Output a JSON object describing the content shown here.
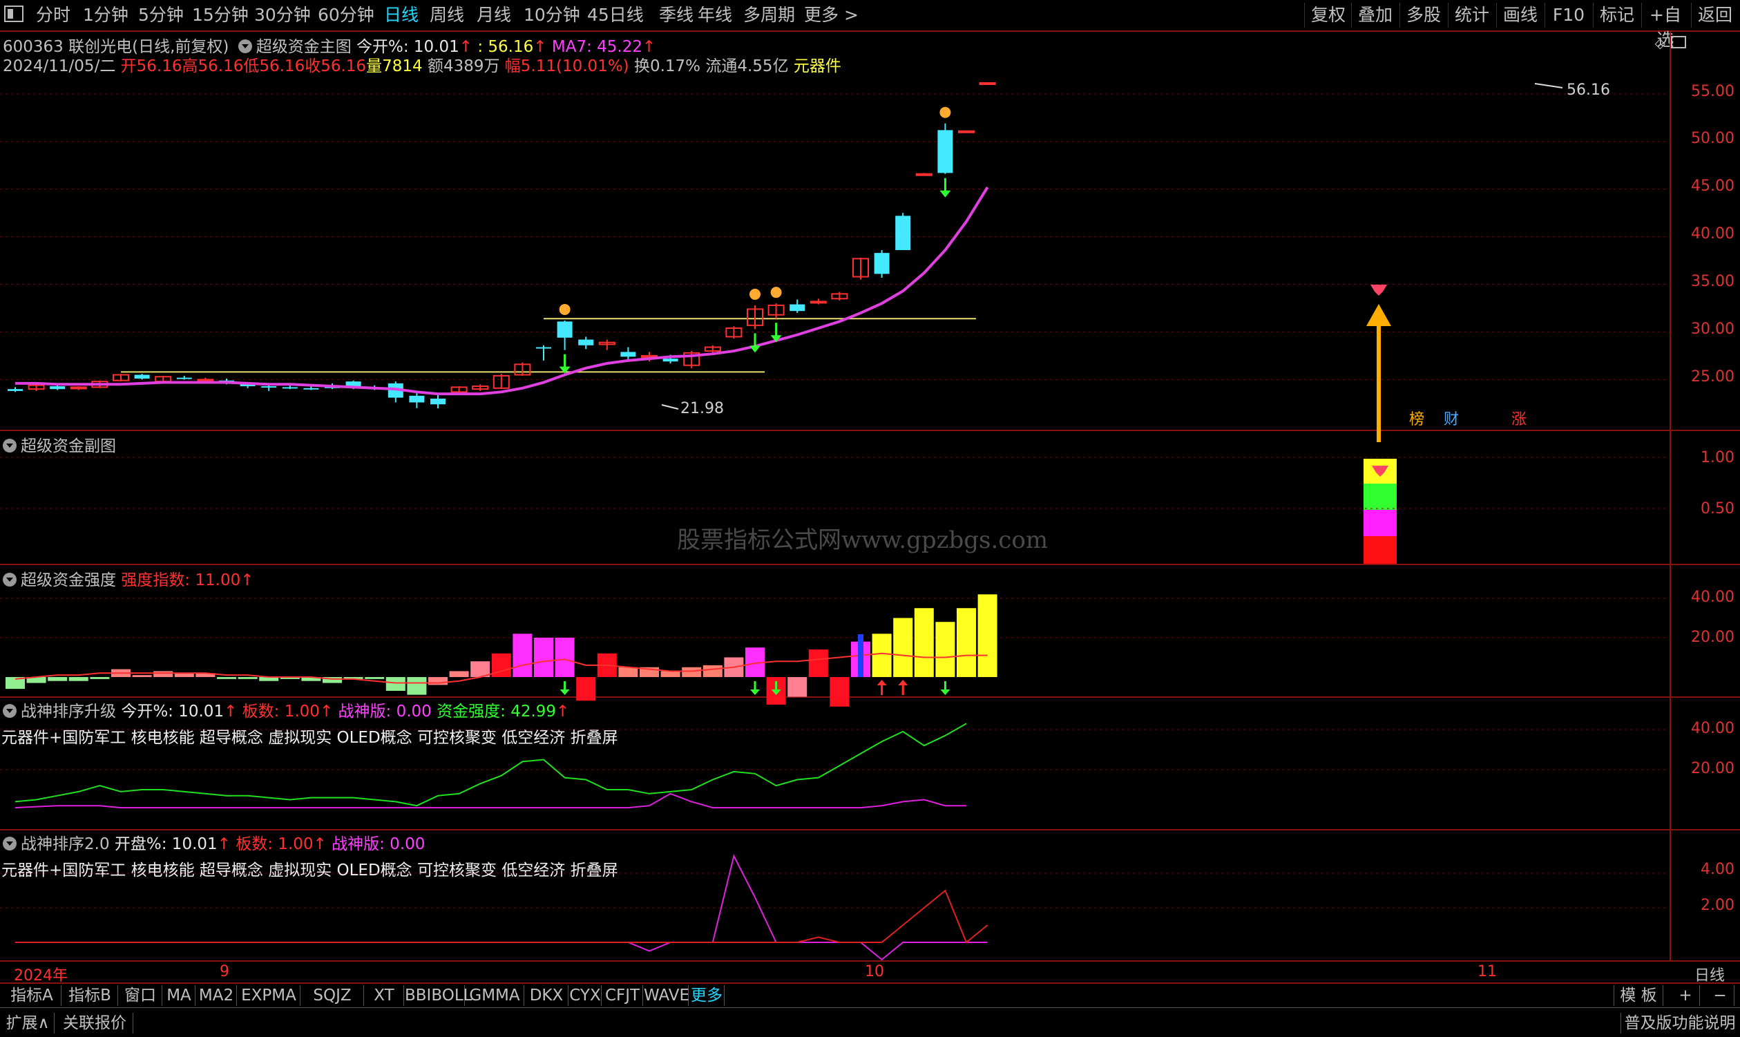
{
  "toolbar": {
    "periods": [
      {
        "label": "分时",
        "active": false
      },
      {
        "label": "1分钟",
        "active": false
      },
      {
        "label": "5分钟",
        "active": false
      },
      {
        "label": "15分钟",
        "active": false
      },
      {
        "label": "30分钟",
        "active": false
      },
      {
        "label": "60分钟",
        "active": false
      },
      {
        "label": "日线",
        "active": true
      },
      {
        "label": "周线",
        "active": false
      },
      {
        "label": "月线",
        "active": false
      },
      {
        "label": "10分钟",
        "active": false
      },
      {
        "label": "45日线",
        "active": false
      },
      {
        "label": "季线",
        "active": false
      },
      {
        "label": "年线",
        "active": false
      },
      {
        "label": "多周期",
        "active": false
      },
      {
        "label": "更多 >",
        "active": false
      }
    ],
    "right_buttons": [
      "复权",
      "叠加",
      "多股",
      "统计",
      "画线",
      "F10",
      "标记",
      "+自选",
      "返回"
    ]
  },
  "main_panel": {
    "stock_title": "600363 联创光电(日线,前复权)",
    "indicator_name": "超级资金主图",
    "today_open_label": "今开%: 10.01",
    "price_label": ": 56.16",
    "ma7_label": "MA7: 45.22",
    "date": "2024/11/05/二",
    "open": "开56.16",
    "high": "高56.16",
    "low": "低56.16",
    "close": "收56.16",
    "volume": "量7814",
    "amount": "额4389万",
    "change": "幅5.11(10.01%)",
    "turnover": "换0.17%",
    "float_cap": "流通4.55亿",
    "sector": "元器件",
    "high_mark": "56.16",
    "low_mark": "21.98",
    "tags": [
      "榜",
      "财",
      "涨"
    ],
    "y_ticks": [
      "55.00",
      "50.00",
      "45.00",
      "40.00",
      "35.00",
      "30.00",
      "25.00"
    ]
  },
  "sub_panel": {
    "title": "超级资金副图",
    "y_ticks": [
      "1.00",
      "0.50"
    ],
    "watermark": "股票指标公式网www.gpzbgs.com"
  },
  "strength_panel": {
    "title": "超级资金强度",
    "index_label": "强度指数: 11.00",
    "y_ticks": [
      "40.00",
      "20.00"
    ]
  },
  "zs_upgrade_panel": {
    "title": "战神排序升级",
    "open_label": "今开%: 10.01",
    "board_label": "板数: 1.00",
    "zsb_label": "战神版: 0.00",
    "fund_label": "资金强度: 42.99",
    "concepts": "元器件+国防军工 核电核能 超导概念 虚拟现实 OLED概念 可控核聚变 低空经济 折叠屏",
    "y_ticks": [
      "40.00",
      "20.00"
    ]
  },
  "zs2_panel": {
    "title": "战神排序2.0",
    "open_label": "开盘%: 10.01",
    "board_label": "板数: 1.00",
    "zsb_label": "战神版: 0.00",
    "concepts": "元器件+国防军工 核电核能 超导概念 虚拟现实 OLED概念 可控核聚变 低空经济 折叠屏",
    "y_ticks": [
      "4.00",
      "2.00"
    ]
  },
  "date_axis": {
    "labels": [
      "2024年",
      "9",
      "10",
      "11"
    ],
    "period_label": "日线"
  },
  "indicator_tabs": [
    "指标A",
    "指标B",
    "窗口",
    "MA",
    "MA2",
    "EXPMA",
    "SQJZ",
    "XT",
    "BBIBOLL",
    "GMMA",
    "DKX",
    "CYX",
    "CFJT",
    "WAVE",
    "更多"
  ],
  "indicator_right": [
    "模 板",
    "+",
    "−"
  ],
  "bottom_bar": {
    "left": [
      "扩展∧",
      "关联报价"
    ],
    "right": "普及版功能说明"
  },
  "colors": {
    "up": "#ff3030",
    "down": "#44e8ff",
    "ma": "#e040e0",
    "grid": "#8b1010"
  },
  "chart_data": {
    "type": "candlestick",
    "ylim": [
      21,
      57
    ],
    "candles": [
      {
        "o": 24.0,
        "h": 24.2,
        "l": 23.7,
        "c": 23.8
      },
      {
        "o": 24.0,
        "h": 24.6,
        "l": 23.8,
        "c": 24.4
      },
      {
        "o": 24.3,
        "h": 24.5,
        "l": 23.9,
        "c": 24.0
      },
      {
        "o": 24.1,
        "h": 24.3,
        "l": 23.9,
        "c": 24.2
      },
      {
        "o": 24.2,
        "h": 24.9,
        "l": 24.1,
        "c": 24.8
      },
      {
        "o": 24.9,
        "h": 25.6,
        "l": 24.8,
        "c": 25.5
      },
      {
        "o": 25.5,
        "h": 25.6,
        "l": 25.0,
        "c": 25.1
      },
      {
        "o": 24.8,
        "h": 25.4,
        "l": 24.7,
        "c": 25.3
      },
      {
        "o": 25.2,
        "h": 25.4,
        "l": 25.0,
        "c": 25.1
      },
      {
        "o": 25.0,
        "h": 25.2,
        "l": 24.8,
        "c": 25.0
      },
      {
        "o": 24.9,
        "h": 25.1,
        "l": 24.5,
        "c": 24.6
      },
      {
        "o": 24.5,
        "h": 24.6,
        "l": 24.1,
        "c": 24.3
      },
      {
        "o": 24.3,
        "h": 24.5,
        "l": 23.8,
        "c": 24.2
      },
      {
        "o": 24.2,
        "h": 24.4,
        "l": 24.0,
        "c": 24.1
      },
      {
        "o": 24.1,
        "h": 24.3,
        "l": 23.9,
        "c": 24.0
      },
      {
        "o": 24.3,
        "h": 24.6,
        "l": 24.0,
        "c": 24.1
      },
      {
        "o": 24.8,
        "h": 24.9,
        "l": 24.0,
        "c": 24.1
      },
      {
        "o": 24.2,
        "h": 24.4,
        "l": 23.9,
        "c": 24.0
      },
      {
        "o": 24.6,
        "h": 24.8,
        "l": 22.6,
        "c": 23.1
      },
      {
        "o": 23.3,
        "h": 23.6,
        "l": 22.0,
        "c": 22.6
      },
      {
        "o": 23.0,
        "h": 23.4,
        "l": 21.98,
        "c": 22.4
      },
      {
        "o": 23.7,
        "h": 24.3,
        "l": 23.5,
        "c": 24.2
      },
      {
        "o": 24.0,
        "h": 24.5,
        "l": 23.8,
        "c": 24.3
      },
      {
        "o": 24.1,
        "h": 25.6,
        "l": 24.0,
        "c": 25.4
      },
      {
        "o": 25.5,
        "h": 26.8,
        "l": 25.4,
        "c": 26.6
      },
      {
        "o": 28.4,
        "h": 28.6,
        "l": 27.0,
        "c": 28.3
      },
      {
        "o": 31.1,
        "h": 31.2,
        "l": 28.1,
        "c": 29.4
      },
      {
        "o": 29.2,
        "h": 29.5,
        "l": 28.2,
        "c": 28.6
      },
      {
        "o": 28.7,
        "h": 29.2,
        "l": 28.1,
        "c": 28.9
      },
      {
        "o": 27.9,
        "h": 28.4,
        "l": 27.1,
        "c": 27.4
      },
      {
        "o": 27.4,
        "h": 27.9,
        "l": 26.9,
        "c": 27.5
      },
      {
        "o": 27.2,
        "h": 27.6,
        "l": 26.7,
        "c": 26.9
      },
      {
        "o": 26.5,
        "h": 28.0,
        "l": 26.2,
        "c": 27.8
      },
      {
        "o": 28.0,
        "h": 28.6,
        "l": 27.8,
        "c": 28.4
      },
      {
        "o": 29.5,
        "h": 30.6,
        "l": 29.3,
        "c": 30.4
      },
      {
        "o": 30.7,
        "h": 32.8,
        "l": 30.3,
        "c": 32.4
      },
      {
        "o": 31.8,
        "h": 33.0,
        "l": 31.4,
        "c": 32.8
      },
      {
        "o": 32.9,
        "h": 33.4,
        "l": 32.0,
        "c": 32.2
      },
      {
        "o": 33.1,
        "h": 33.5,
        "l": 32.9,
        "c": 33.2
      },
      {
        "o": 33.5,
        "h": 34.2,
        "l": 33.3,
        "c": 34.0
      },
      {
        "o": 35.8,
        "h": 37.8,
        "l": 35.5,
        "c": 37.7
      },
      {
        "o": 38.3,
        "h": 38.6,
        "l": 35.7,
        "c": 36.1
      },
      {
        "o": 42.2,
        "h": 42.5,
        "l": 38.6,
        "c": 38.6
      },
      {
        "o": 46.6,
        "h": 46.7,
        "l": 46.5,
        "c": 46.6
      },
      {
        "o": 51.2,
        "h": 51.9,
        "l": 46.6,
        "c": 46.7
      },
      {
        "o": 51.1,
        "h": 51.1,
        "l": 51.0,
        "c": 51.1
      },
      {
        "o": 56.16,
        "h": 56.16,
        "l": 56.16,
        "c": 56.16
      }
    ],
    "ma": [
      24.6,
      24.6,
      24.5,
      24.5,
      24.5,
      24.5,
      24.6,
      24.7,
      24.7,
      24.7,
      24.7,
      24.6,
      24.5,
      24.5,
      24.4,
      24.3,
      24.2,
      24.1,
      24.0,
      23.7,
      23.5,
      23.5,
      23.5,
      23.7,
      24.1,
      24.7,
      25.5,
      26.2,
      26.7,
      27.0,
      27.2,
      27.4,
      27.5,
      27.7,
      28.0,
      28.5,
      29.1,
      29.7,
      30.4,
      31.1,
      32.0,
      33.0,
      34.3,
      36.2,
      38.6,
      41.6,
      45.2
    ],
    "hlines": [
      {
        "y": 25.8,
        "from": 5,
        "to": 35
      },
      {
        "y": 31.4,
        "from": 25,
        "to": 45
      }
    ],
    "strength": [
      -6,
      -3,
      -2,
      -2,
      -1,
      4,
      1,
      3,
      2,
      2,
      -1,
      -1,
      -2,
      -1,
      -2,
      -3,
      -1,
      -1,
      -7,
      -9,
      -4,
      3,
      8,
      12,
      22,
      20,
      20,
      -12,
      12,
      5,
      5,
      3,
      5,
      6,
      10,
      15,
      -14,
      -10,
      14,
      -15,
      18,
      22,
      30,
      35,
      28,
      35,
      42
    ],
    "strength_colors": [
      "g",
      "g",
      "g",
      "g",
      "g",
      "r",
      "r",
      "r",
      "r",
      "r",
      "g",
      "g",
      "g",
      "g",
      "g",
      "g",
      "g",
      "g",
      "g",
      "g",
      "r",
      "r",
      "p",
      "R",
      "M",
      "M",
      "M",
      "R",
      "R",
      "s",
      "s",
      "s",
      "s",
      "s",
      "p",
      "M",
      "R",
      "p",
      "R",
      "R",
      "M",
      "Y",
      "Y",
      "Y",
      "Y",
      "Y",
      "Y"
    ],
    "strength_line": [
      -1,
      0,
      1,
      1,
      2,
      2,
      2,
      2,
      2,
      2,
      1,
      1,
      0,
      0,
      0,
      -1,
      -1,
      -2,
      -3,
      -3,
      -3,
      -2,
      0,
      3,
      6,
      8,
      9,
      6,
      6,
      5,
      4,
      3,
      3,
      4,
      5,
      7,
      8,
      8,
      9,
      10,
      11,
      12,
      11,
      10,
      10,
      11,
      11
    ],
    "zs_green": [
      4,
      5,
      7,
      9,
      12,
      9,
      10,
      10,
      9,
      8,
      7,
      7,
      6,
      5,
      6,
      6,
      6,
      5,
      4,
      2,
      7,
      8,
      13,
      17,
      24,
      25,
      16,
      15,
      10,
      10,
      8,
      9,
      10,
      15,
      19,
      18,
      12,
      15,
      16,
      22,
      28,
      34,
      39,
      32,
      37,
      43
    ],
    "zs_magenta": [
      1,
      1.5,
      2,
      2,
      2,
      1,
      1,
      1,
      1,
      1,
      1,
      1,
      1,
      1,
      1,
      1,
      1,
      1,
      1,
      1,
      1,
      1,
      1,
      1,
      1,
      1,
      1,
      1,
      1,
      1,
      2,
      8,
      4,
      1,
      1,
      1,
      1,
      1,
      1,
      1,
      1,
      2,
      4,
      5,
      2,
      2
    ],
    "zs2_magenta": [
      0,
      0,
      0,
      0,
      0,
      0,
      0,
      0,
      0,
      0,
      0,
      0,
      0,
      0,
      0,
      0,
      0,
      0,
      0,
      0,
      0,
      0,
      0,
      0,
      0,
      0,
      0,
      0,
      0,
      0,
      -0.5,
      0,
      0,
      0,
      5,
      2.6,
      0,
      0,
      0,
      0,
      0,
      -1,
      0,
      0,
      0,
      0,
      0
    ],
    "zs2_red": [
      0,
      0,
      0,
      0,
      0,
      0,
      0,
      0,
      0,
      0,
      0,
      0,
      0,
      0,
      0,
      0,
      0,
      0,
      0,
      0,
      0,
      0,
      0,
      0,
      0,
      0,
      0,
      0,
      0,
      0,
      0,
      0,
      0,
      0,
      0,
      0,
      0,
      0,
      0.3,
      0,
      0,
      0,
      1,
      2,
      3,
      0,
      1
    ]
  }
}
